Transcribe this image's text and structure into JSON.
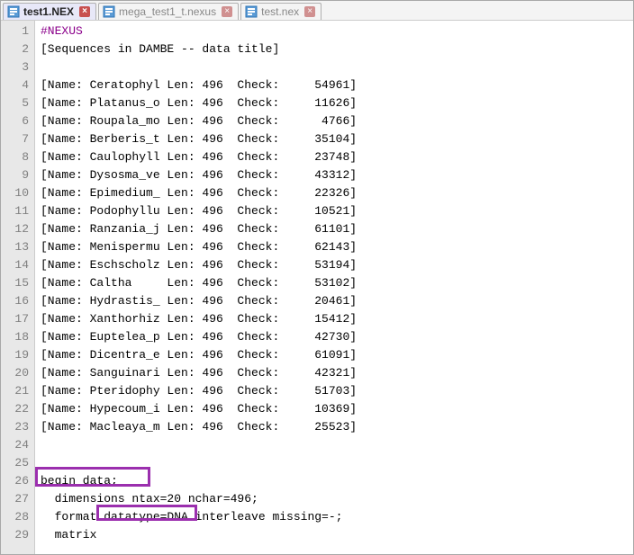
{
  "tabs": [
    {
      "label": "test1.NEX",
      "active": true
    },
    {
      "label": "mega_test1_t.nexus",
      "active": false
    },
    {
      "label": "test.nex",
      "active": false
    }
  ],
  "sequences": [
    {
      "name": "Ceratophyl",
      "len": 496,
      "check": 54961
    },
    {
      "name": "Platanus_o",
      "len": 496,
      "check": 11626
    },
    {
      "name": "Roupala_mo",
      "len": 496,
      "check": 4766
    },
    {
      "name": "Berberis_t",
      "len": 496,
      "check": 35104
    },
    {
      "name": "Caulophyll",
      "len": 496,
      "check": 23748
    },
    {
      "name": "Dysosma_ve",
      "len": 496,
      "check": 43312
    },
    {
      "name": "Epimedium_",
      "len": 496,
      "check": 22326
    },
    {
      "name": "Podophyllu",
      "len": 496,
      "check": 10521
    },
    {
      "name": "Ranzania_j",
      "len": 496,
      "check": 61101
    },
    {
      "name": "Menispermu",
      "len": 496,
      "check": 62143
    },
    {
      "name": "Eschscholz",
      "len": 496,
      "check": 53194
    },
    {
      "name": "Caltha",
      "len": 496,
      "check": 53102
    },
    {
      "name": "Hydrastis_",
      "len": 496,
      "check": 20461
    },
    {
      "name": "Xanthorhiz",
      "len": 496,
      "check": 15412
    },
    {
      "name": "Euptelea_p",
      "len": 496,
      "check": 42730
    },
    {
      "name": "Dicentra_e",
      "len": 496,
      "check": 61091
    },
    {
      "name": "Sanguinari",
      "len": 496,
      "check": 42321
    },
    {
      "name": "Pteridophy",
      "len": 496,
      "check": 51703
    },
    {
      "name": "Hypecoum_i",
      "len": 496,
      "check": 10369
    },
    {
      "name": "Macleaya_m",
      "len": 496,
      "check": 25523
    }
  ],
  "strings": {
    "header": "#NEXUS",
    "title_comment": "[Sequences in DAMBE -- data title]",
    "begin_data": "begin data;",
    "dimensions": "  dimensions ntax=20 nchar=496;",
    "format_pre": "  format ",
    "datatype": "datatype=DNA",
    "format_post": " interleave missing=-;",
    "matrix": "  matrix"
  }
}
